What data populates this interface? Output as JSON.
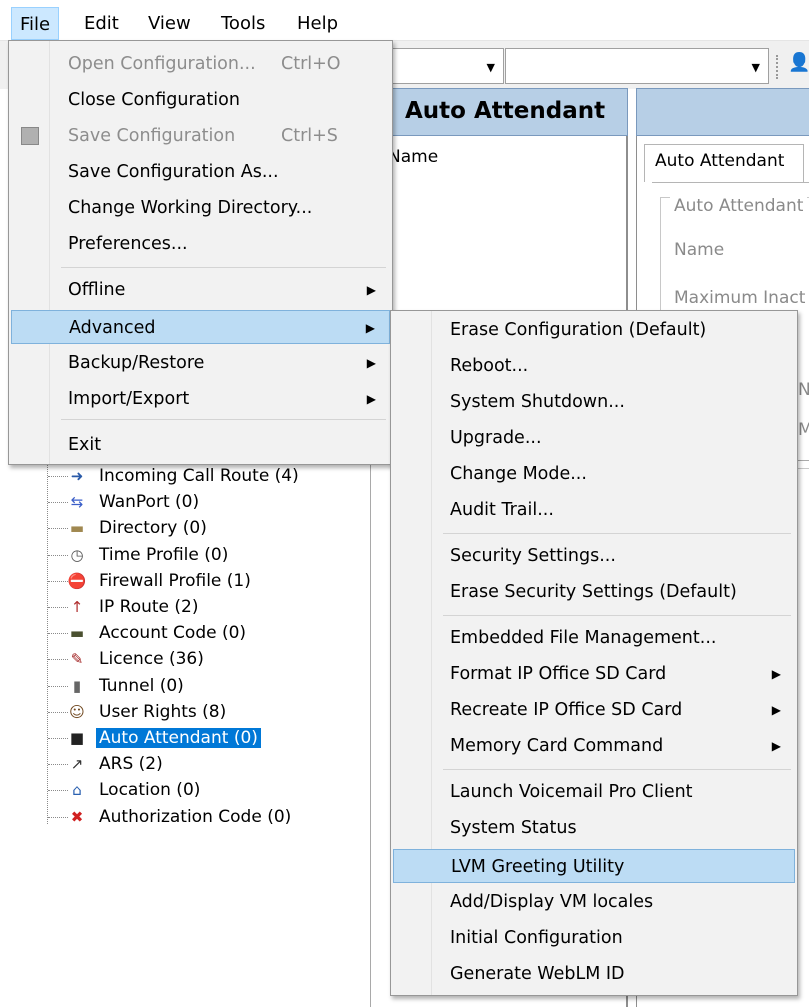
{
  "menubar": {
    "items": [
      "File",
      "Edit",
      "View",
      "Tools",
      "Help"
    ]
  },
  "mid_panel": {
    "header": "Auto Attendant",
    "column_label": "Name"
  },
  "right_panel": {
    "tab": "Auto Attendant",
    "group_label": "Auto Attendant",
    "name_label": "Name",
    "max_inactivity_label": "Maximum Inact",
    "fragment_n": "N",
    "fragment_m": "M"
  },
  "tree": {
    "items": [
      {
        "label": "Incoming Call Route (4)",
        "icon": "incoming-call-route-icon"
      },
      {
        "label": "WanPort (0)",
        "icon": "wanport-icon"
      },
      {
        "label": "Directory (0)",
        "icon": "directory-icon"
      },
      {
        "label": "Time Profile (0)",
        "icon": "clock-icon"
      },
      {
        "label": "Firewall Profile (1)",
        "icon": "firewall-icon"
      },
      {
        "label": "IP Route (2)",
        "icon": "ip-route-icon"
      },
      {
        "label": "Account Code (0)",
        "icon": "account-code-icon"
      },
      {
        "label": "Licence (36)",
        "icon": "licence-icon"
      },
      {
        "label": "Tunnel (0)",
        "icon": "tunnel-icon"
      },
      {
        "label": "User Rights (8)",
        "icon": "user-rights-icon"
      },
      {
        "label": "Auto Attendant (0)",
        "icon": "auto-attendant-icon",
        "selected": true
      },
      {
        "label": "ARS (2)",
        "icon": "ars-icon"
      },
      {
        "label": "Location (0)",
        "icon": "location-icon"
      },
      {
        "label": "Authorization Code (0)",
        "icon": "authorization-code-icon"
      }
    ]
  },
  "file_menu": {
    "items": [
      {
        "label": "Open Configuration...",
        "shortcut": "Ctrl+O",
        "disabled": true
      },
      {
        "label": "Close Configuration"
      },
      {
        "label": "Save Configuration",
        "shortcut": "Ctrl+S",
        "disabled": true,
        "icon": "save-icon"
      },
      {
        "label": "Save Configuration As..."
      },
      {
        "label": "Change Working Directory..."
      },
      {
        "label": "Preferences..."
      },
      {
        "label": "Offline",
        "submenu": true
      },
      {
        "label": "Advanced",
        "submenu": true,
        "highlighted": true
      },
      {
        "label": "Backup/Restore",
        "submenu": true
      },
      {
        "label": "Import/Export",
        "submenu": true
      },
      {
        "label": "Exit"
      }
    ]
  },
  "advanced_menu": {
    "items": [
      {
        "label": "Erase Configuration (Default)"
      },
      {
        "label": "Reboot..."
      },
      {
        "label": "System Shutdown..."
      },
      {
        "label": "Upgrade..."
      },
      {
        "label": "Change Mode..."
      },
      {
        "label": "Audit Trail..."
      },
      {
        "label": "Security Settings..."
      },
      {
        "label": "Erase Security Settings (Default)"
      },
      {
        "label": "Embedded File Management..."
      },
      {
        "label": "Format IP Office SD Card",
        "submenu": true
      },
      {
        "label": "Recreate IP Office SD Card",
        "submenu": true
      },
      {
        "label": "Memory Card Command",
        "submenu": true
      },
      {
        "label": "Launch Voicemail Pro Client"
      },
      {
        "label": "System Status"
      },
      {
        "label": "LVM Greeting Utility",
        "highlighted": true
      },
      {
        "label": "Add/Display VM locales"
      },
      {
        "label": "Initial Configuration"
      },
      {
        "label": "Generate WebLM ID"
      }
    ]
  },
  "colors": {
    "selection": "#0078d7",
    "menu_highlight": "#bcdcf4",
    "panel_header": "#b7cfe6"
  }
}
